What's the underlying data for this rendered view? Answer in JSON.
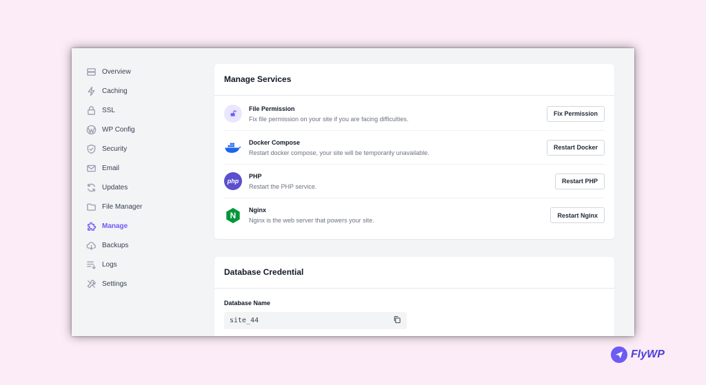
{
  "sidebar": {
    "items": [
      {
        "label": "Overview",
        "icon": "server-icon"
      },
      {
        "label": "Caching",
        "icon": "bolt-icon"
      },
      {
        "label": "SSL",
        "icon": "lock-icon"
      },
      {
        "label": "WP Config",
        "icon": "wordpress-icon"
      },
      {
        "label": "Security",
        "icon": "shield-icon"
      },
      {
        "label": "Email",
        "icon": "mail-icon"
      },
      {
        "label": "Updates",
        "icon": "refresh-icon"
      },
      {
        "label": "File Manager",
        "icon": "folder-icon"
      },
      {
        "label": "Manage",
        "icon": "puzzle-icon",
        "active": true
      },
      {
        "label": "Backups",
        "icon": "cloud-download-icon"
      },
      {
        "label": "Logs",
        "icon": "list-icon"
      },
      {
        "label": "Settings",
        "icon": "tools-icon"
      }
    ]
  },
  "services": {
    "title": "Manage Services",
    "items": [
      {
        "title": "File Permission",
        "desc": "Fix file permission on your site if you are facing difficulties.",
        "button": "Fix Permission",
        "icon": "unlock-icon"
      },
      {
        "title": "Docker Compose",
        "desc": "Restart docker compose, your site will be temporarily unavailable.",
        "button": "Restart Docker",
        "icon": "docker-icon"
      },
      {
        "title": "PHP",
        "desc": "Restart the PHP service.",
        "button": "Restart PHP",
        "icon": "php-icon",
        "icon_text": "php"
      },
      {
        "title": "Nginx",
        "desc": "Nginx is the web server that powers your site.",
        "button": "Restart Nginx",
        "icon": "nginx-icon",
        "icon_text": "N"
      }
    ]
  },
  "database": {
    "title": "Database Credential",
    "name_label": "Database Name",
    "name_value": "site_44"
  },
  "brand": {
    "name": "FlyWP"
  },
  "colors": {
    "accent": "#6d5bf5",
    "background": "#fcecf7",
    "docker": "#1d63ed",
    "php": "#5a4fcf",
    "nginx": "#009639"
  }
}
